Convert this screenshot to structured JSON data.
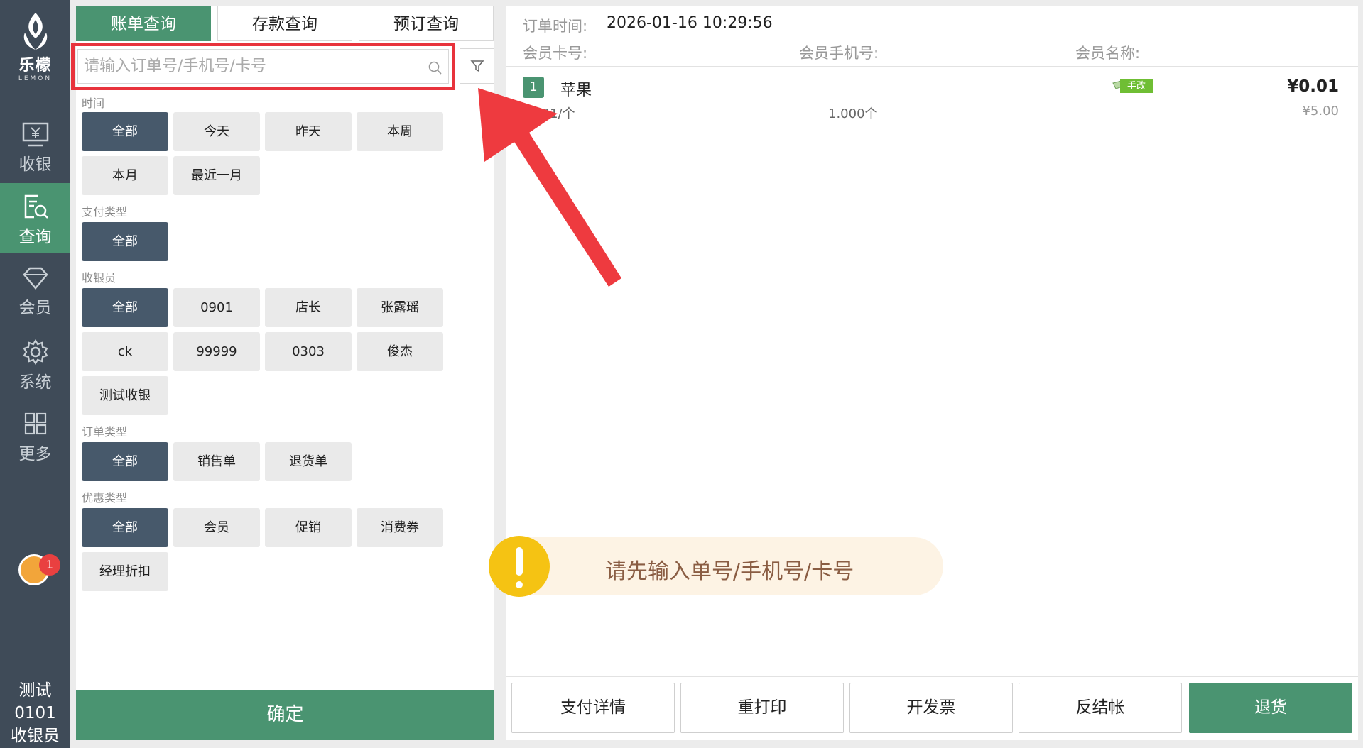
{
  "sidebar": {
    "brand": "乐檬",
    "brand_sub": "LEMON",
    "items": [
      {
        "label": "收银",
        "icon": "cashier-monitor-icon"
      },
      {
        "label": "查询",
        "icon": "query-document-icon"
      },
      {
        "label": "会员",
        "icon": "diamond-icon"
      },
      {
        "label": "系统",
        "icon": "gear-icon"
      },
      {
        "label": "更多",
        "icon": "grid-icon"
      }
    ],
    "active": "查询",
    "notification_count": "1",
    "user_name": "测试0101",
    "user_role": "收银员"
  },
  "left": {
    "tabs": [
      {
        "label": "账单查询",
        "active": true
      },
      {
        "label": "存款查询",
        "active": false
      },
      {
        "label": "预订查询",
        "active": false
      }
    ],
    "search_placeholder": "请输入订单号/手机号/卡号",
    "sections": {
      "time": {
        "label": "时间",
        "options": [
          "全部",
          "今天",
          "昨天",
          "本周",
          "本月",
          "最近一月"
        ],
        "selected": "全部"
      },
      "pay_type": {
        "label": "支付类型",
        "options": [
          "全部"
        ],
        "selected": "全部"
      },
      "cashier": {
        "label": "收银员",
        "options": [
          "全部",
          "0901",
          "店长",
          "张露瑶",
          "ck",
          "99999",
          "0303",
          "俊杰",
          "测试收银"
        ],
        "selected": "全部"
      },
      "order_type": {
        "label": "订单类型",
        "options": [
          "全部",
          "销售单",
          "退货单"
        ],
        "selected": "全部"
      },
      "discount_type": {
        "label": "优惠类型",
        "options": [
          "全部",
          "会员",
          "促销",
          "消费券",
          "经理折扣"
        ],
        "selected": "全部"
      }
    },
    "confirm_label": "确定"
  },
  "right": {
    "order_time_label": "订单时间:",
    "order_time": "2026-01-16 10:29:56",
    "member_card_label": "会员卡号:",
    "member_phone_label": "会员手机号:",
    "member_name_label": "会员名称:",
    "items": [
      {
        "index": "1",
        "name": "苹果",
        "price": "¥0.01",
        "unit_price": "¥0.01/个",
        "qty": "1.000个",
        "original_price": "¥5.00",
        "tag": "手改"
      }
    ],
    "buttons": [
      "支付详情",
      "重打印",
      "开发票",
      "反结帐",
      "退货"
    ]
  },
  "toast": {
    "message": "请先输入单号/手机号/卡号"
  },
  "colors": {
    "sidebar": "#3f4b58",
    "accent_green": "#4a9471",
    "chip_selected": "#47596b",
    "highlight_red": "#e8333c",
    "toast_bg": "#fdf3e4",
    "toast_icon": "#f5c313"
  }
}
